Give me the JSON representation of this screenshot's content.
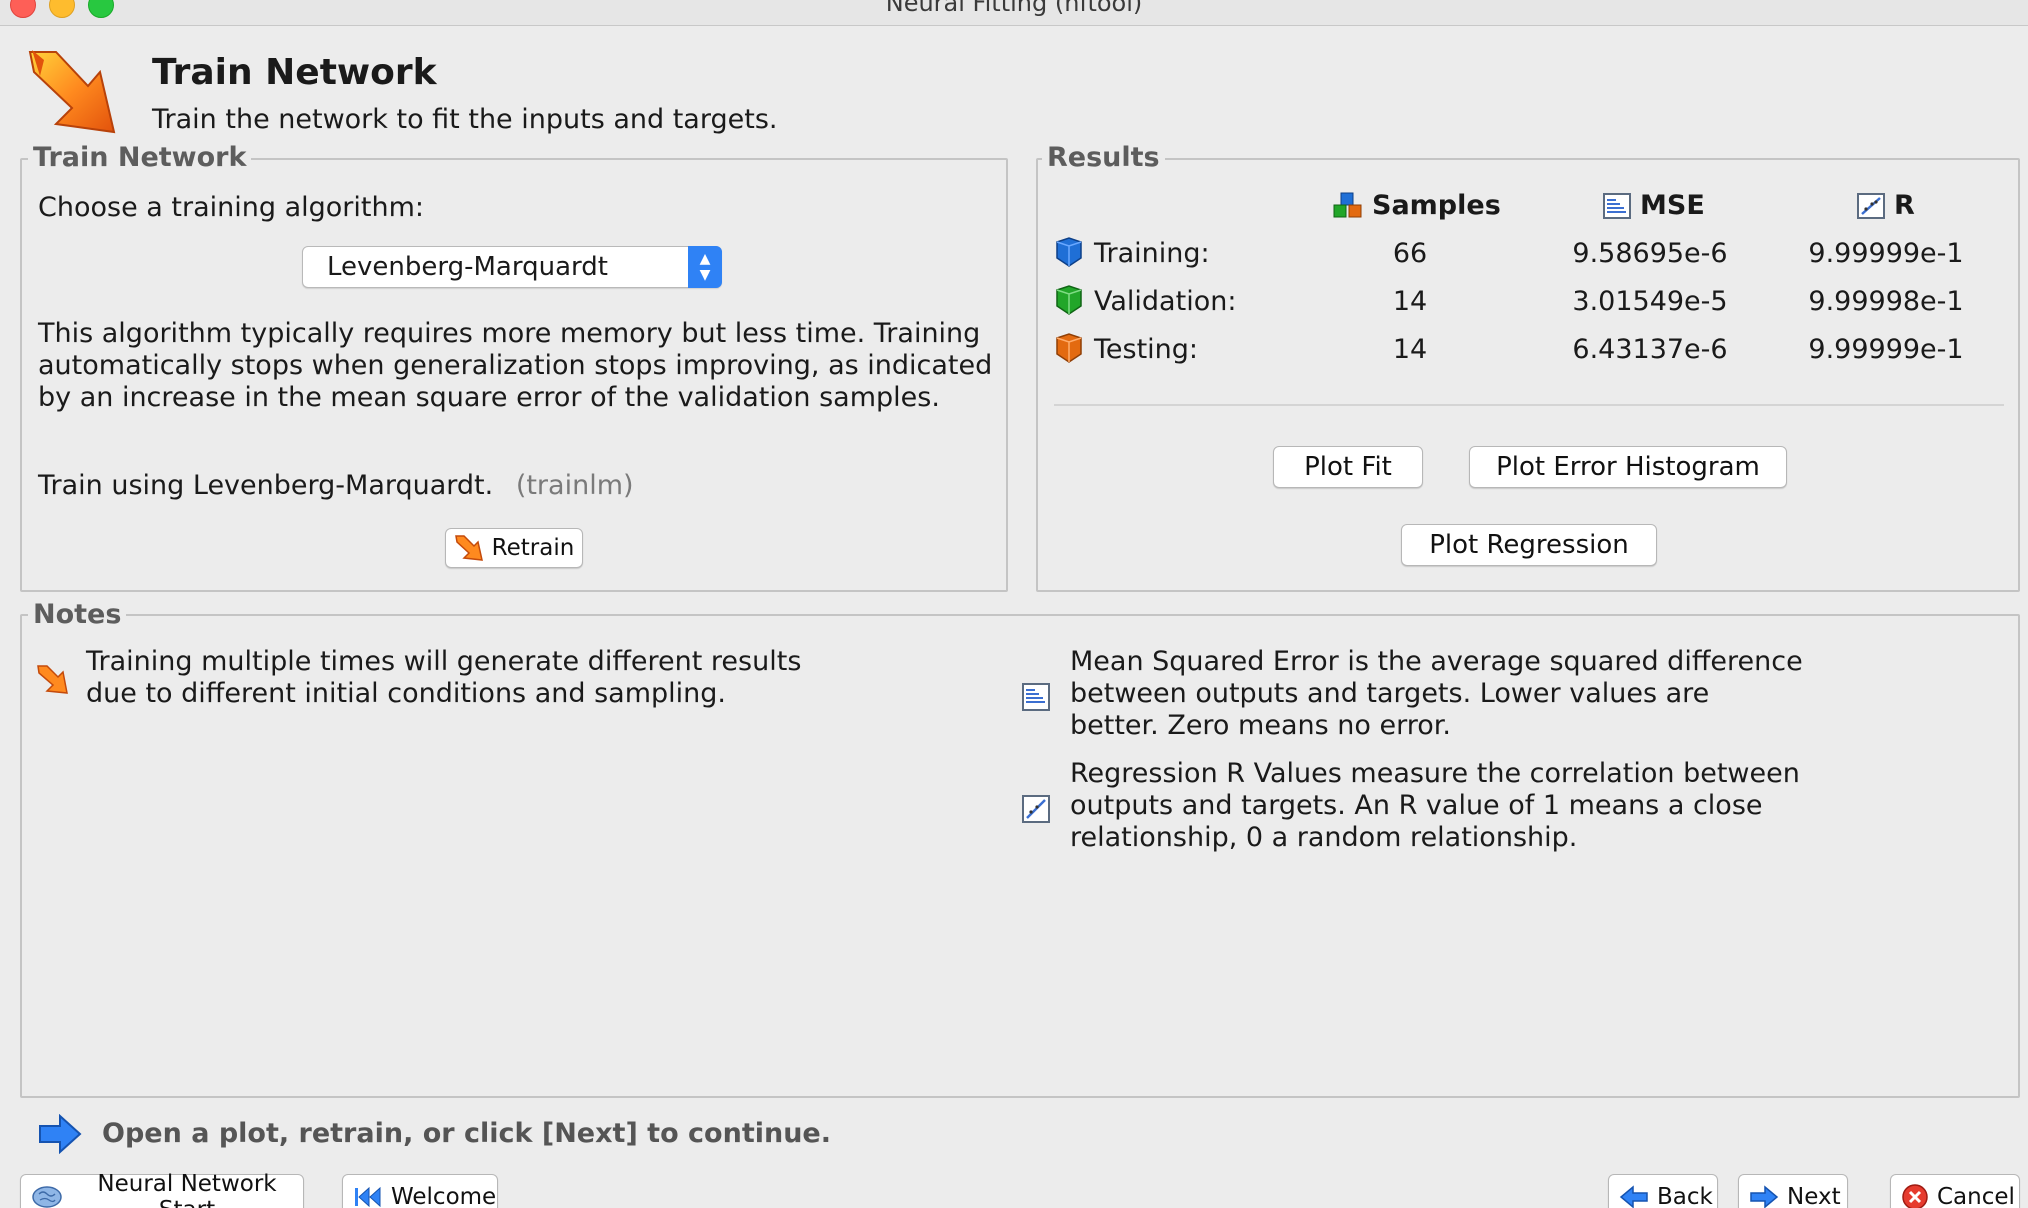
{
  "window": {
    "title": "Neural Fitting (nftool)"
  },
  "header": {
    "title": "Train Network",
    "subtitle": "Train the network to fit the inputs and targets."
  },
  "train_panel": {
    "legend": "Train Network",
    "choose_label": "Choose a training algorithm:",
    "algorithm_selected": "Levenberg-Marquardt",
    "description": "This algorithm typically requires more memory but less time. Training automatically stops when generalization stops improving, as indicated by an increase in the mean square error of the validation samples.",
    "train_using": "Train using Levenberg-Marquardt.",
    "train_fn": "(trainlm)",
    "retrain_label": "Retrain"
  },
  "results": {
    "legend": "Results",
    "columns": [
      "Samples",
      "MSE",
      "R"
    ],
    "rows": [
      {
        "label": "Training:",
        "samples": "66",
        "mse": "9.58695e-6",
        "r": "9.99999e-1",
        "color": "#1f6fd6"
      },
      {
        "label": "Validation:",
        "samples": "14",
        "mse": "3.01549e-5",
        "r": "9.99998e-1",
        "color": "#22a629"
      },
      {
        "label": "Testing:",
        "samples": "14",
        "mse": "6.43137e-6",
        "r": "9.99999e-1",
        "color": "#e36a10"
      }
    ],
    "plot_fit": "Plot Fit",
    "plot_error_histogram": "Plot Error Histogram",
    "plot_regression": "Plot Regression"
  },
  "notes": {
    "legend": "Notes",
    "note1_line1": "Training multiple times will generate different results",
    "note1_line2": "due to different initial conditions and sampling.",
    "note2_line1": "Mean Squared Error is the average squared difference",
    "note2_line2": "between outputs and targets. Lower values are",
    "note2_line3": "better. Zero means no error.",
    "note3_line1": "Regression R Values measure the correlation between",
    "note3_line2": "outputs and targets. An R value of 1 means a close",
    "note3_line3": "relationship, 0 a random relationship."
  },
  "status": {
    "message": "Open a plot, retrain, or click [Next] to continue."
  },
  "footer": {
    "nn_start": "Neural Network Start",
    "welcome": "Welcome",
    "back": "Back",
    "next": "Next",
    "cancel": "Cancel"
  },
  "icons": {
    "train": "train-arrow-icon",
    "samples": "cubes-icon",
    "mse": "mse-chart-icon",
    "r": "regression-icon"
  }
}
